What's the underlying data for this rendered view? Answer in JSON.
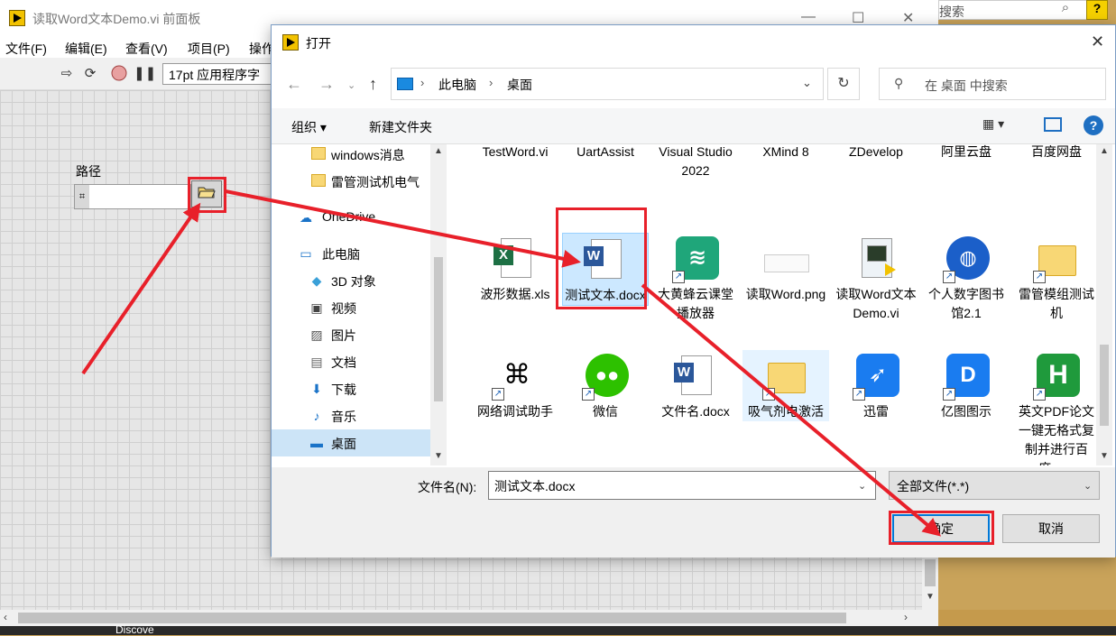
{
  "lv": {
    "title": "读取Word文本Demo.vi 前面板",
    "search_placeholder": "搜索",
    "menus": [
      "文件(F)",
      "编辑(E)",
      "查看(V)",
      "项目(P)",
      "操作"
    ],
    "font_select": "17pt 应用程序字",
    "path_label": "路径",
    "path_value": "",
    "taskbar_text": "Discove"
  },
  "dialog": {
    "title": "打开",
    "breadcrumb": [
      "此电脑",
      "桌面"
    ],
    "search_placeholder": "在 桌面 中搜索",
    "organize_label": "组织 ▾",
    "new_folder_label": "新建文件夹",
    "nav_items": [
      {
        "label": "windows消息",
        "icon": "folder-icon",
        "selected": false
      },
      {
        "label": "雷管测试机电气",
        "icon": "folder-icon",
        "selected": false
      },
      {
        "label": "OneDrive",
        "icon": "cloud-icon",
        "selected": false
      },
      {
        "label": "此电脑",
        "icon": "pc-icon",
        "selected": false
      },
      {
        "label": "3D 对象",
        "icon": "cube-icon",
        "selected": false
      },
      {
        "label": "视频",
        "icon": "video-icon",
        "selected": false
      },
      {
        "label": "图片",
        "icon": "picture-icon",
        "selected": false
      },
      {
        "label": "文档",
        "icon": "document-icon",
        "selected": false
      },
      {
        "label": "下载",
        "icon": "download-icon",
        "selected": false
      },
      {
        "label": "音乐",
        "icon": "music-icon",
        "selected": false
      },
      {
        "label": "桌面",
        "icon": "desktop-icon",
        "selected": true
      }
    ],
    "files": [
      {
        "label": "TestWord.vi",
        "icon": "labview-vi-icon",
        "row": 0
      },
      {
        "label": "UartAssist",
        "icon": "app-icon",
        "row": 0
      },
      {
        "label": "Visual Studio 2022",
        "icon": "visual-studio-icon",
        "row": 0
      },
      {
        "label": "XMind 8",
        "icon": "xmind-icon",
        "row": 0
      },
      {
        "label": "ZDevelop",
        "icon": "app-icon",
        "row": 0
      },
      {
        "label": "阿里云盘",
        "icon": "cloud-drive-icon",
        "row": 0
      },
      {
        "label": "百度网盘",
        "icon": "cloud-drive-icon",
        "row": 0
      },
      {
        "label": "波形数据.xls",
        "icon": "excel-file-icon",
        "row": 1
      },
      {
        "label": "测试文本.docx",
        "icon": "word-file-icon",
        "row": 1,
        "selected": true
      },
      {
        "label": "大黄蜂云课堂播放器",
        "icon": "player-app-icon",
        "row": 1
      },
      {
        "label": "读取Word.png",
        "icon": "png-image-icon",
        "row": 1
      },
      {
        "label": "读取Word文本Demo.vi",
        "icon": "labview-vi-icon",
        "row": 1
      },
      {
        "label": "个人数字图书馆2.1",
        "icon": "globe-app-icon",
        "row": 1
      },
      {
        "label": "雷管模组测试机",
        "icon": "folder-shortcut-icon",
        "row": 1
      },
      {
        "label": "网络调试助手",
        "icon": "network-app-icon",
        "row": 2
      },
      {
        "label": "微信",
        "icon": "wechat-icon",
        "row": 2
      },
      {
        "label": "文件名.docx",
        "icon": "word-file-icon",
        "row": 2
      },
      {
        "label": "吸气剂电激活",
        "icon": "folder-shortcut-icon",
        "row": 2,
        "hover": true
      },
      {
        "label": "迅雷",
        "icon": "thunder-icon",
        "row": 2
      },
      {
        "label": "亿图图示",
        "icon": "edraw-icon",
        "row": 2
      },
      {
        "label": "英文PDF论文一键无格式复制并进行百度、...",
        "icon": "h-app-icon",
        "row": 2
      }
    ],
    "filename_label": "文件名(N):",
    "filename_value": "测试文本.docx",
    "filetype_value": "全部文件(*.*)",
    "ok_label": "确定",
    "cancel_label": "取消"
  },
  "colors": {
    "annotation_red": "#e8202a",
    "selection_blue": "#cce8ff",
    "accent_blue": "#0078d7"
  }
}
